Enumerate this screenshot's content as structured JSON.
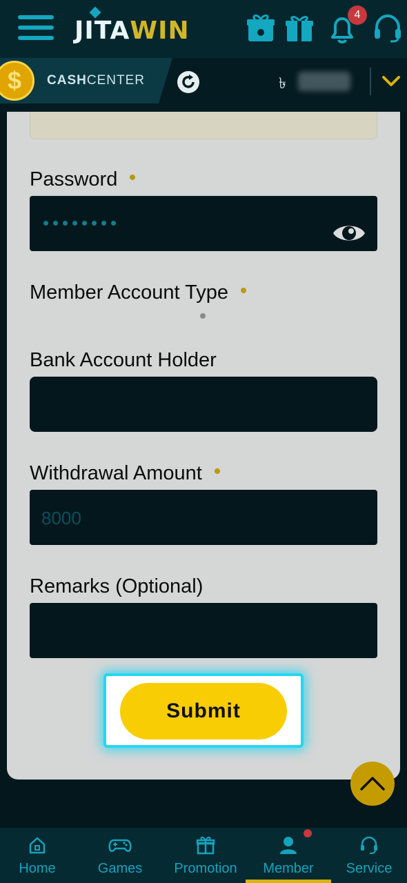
{
  "header": {
    "logo_part1": "JITA",
    "logo_part2": "WIN",
    "notification_count": "4",
    "icons": [
      "menu-icon",
      "gift-box-icon",
      "gift-icon",
      "bell-icon",
      "headset-icon"
    ]
  },
  "cash_bar": {
    "label_bold": "CASH",
    "label_rest": "CENTER",
    "currency_symbol": "৳",
    "icons": [
      "coin-icon",
      "refresh-icon",
      "chevron-down-icon"
    ]
  },
  "form": {
    "password_label": "Password",
    "password_mask_length": 8,
    "member_account_type_label": "Member Account Type",
    "bank_account_holder_label": "Bank Account Holder",
    "withdrawal_amount_label": "Withdrawal Amount",
    "withdrawal_amount_value": "8000",
    "remarks_label": "Remarks (Optional)",
    "submit_label": "Submit"
  },
  "bottom_nav": {
    "items": [
      {
        "label": "Home",
        "icon": "home-icon"
      },
      {
        "label": "Games",
        "icon": "gamepad-icon"
      },
      {
        "label": "Promotion",
        "icon": "gift-icon"
      },
      {
        "label": "Member",
        "icon": "user-icon"
      },
      {
        "label": "Service",
        "icon": "headset-icon"
      }
    ],
    "active": "Member"
  },
  "colors": {
    "accent_teal": "#14a7c0",
    "accent_gold": "#f8cd03",
    "dark_bg": "#03171c",
    "card_bg": "#d5d6d6",
    "badge_red": "#c8383f"
  }
}
